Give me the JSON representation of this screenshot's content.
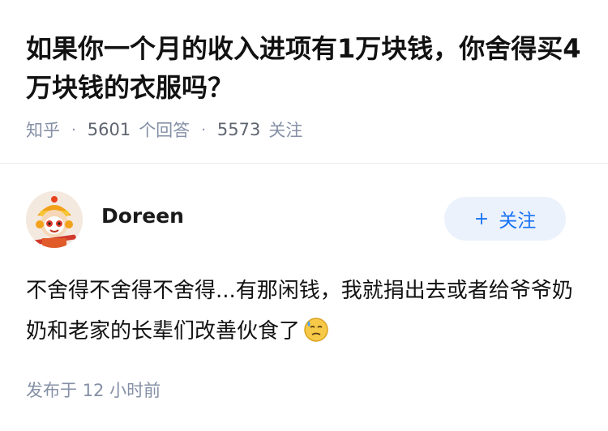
{
  "question": {
    "title": "如果你一个月的收入进项有1万块钱，你舍得买4万块钱的衣服吗？",
    "source": "知乎",
    "answers_count": "5601",
    "answers_label": "个回答",
    "followers_count": "5573",
    "followers_label": "关注"
  },
  "answer": {
    "author_name": "Doreen",
    "follow_button_label": "关注",
    "content": "不舍得不舍得不舍得...有那闲钱，我就捐出去或者给爷爷奶奶和老家的长辈们改善伙食了",
    "emoji": "sweat-emoji",
    "posted_label": "发布于",
    "posted_time": "12 小时前"
  },
  "colors": {
    "accent": "#1772f6",
    "follow_bg": "#ebf2fc",
    "meta_gray": "#8590a6"
  }
}
